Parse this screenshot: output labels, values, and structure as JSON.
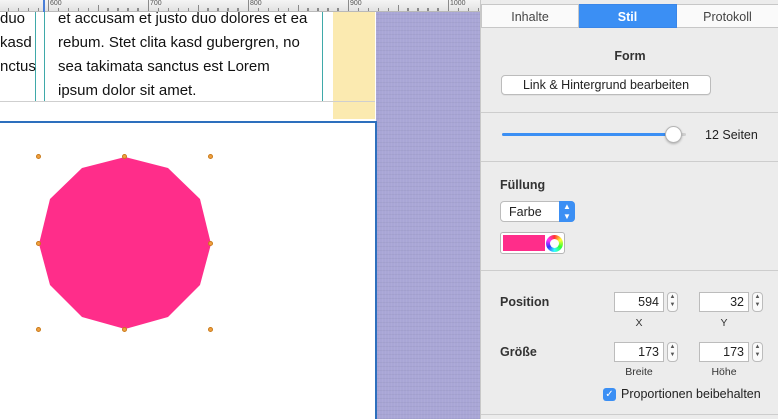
{
  "ruler": {
    "labels": [
      "600",
      "700",
      "800",
      "900",
      "1000"
    ]
  },
  "document": {
    "left_column_lines": [
      "duo",
      "kasd",
      "nctus"
    ],
    "main_column_lines": [
      "et accusam et justo duo dolores et ea",
      "rebum. Stet clita kasd gubergren, no",
      "sea takimata sanctus est Lorem",
      "ipsum dolor sit amet."
    ]
  },
  "shape": {
    "type": "polygon",
    "sides": 12,
    "fill_color": "#ff2d8a"
  },
  "inspector": {
    "tabs": [
      {
        "label": "Inhalte",
        "active": false
      },
      {
        "label": "Stil",
        "active": true
      },
      {
        "label": "Protokoll",
        "active": false
      }
    ],
    "form_section": {
      "title": "Form",
      "button_label": "Link & Hintergrund bearbeiten"
    },
    "sides_slider": {
      "fraction": 0.93,
      "label": "12 Seiten"
    },
    "fill_section": {
      "title": "Füllung",
      "select_value": "Farbe",
      "color": "#ff2d8a"
    },
    "position_section": {
      "title": "Position",
      "x_value": "594",
      "y_value": "32",
      "x_label": "X",
      "y_label": "Y"
    },
    "size_section": {
      "title": "Größe",
      "width_value": "173",
      "height_value": "173",
      "width_label": "Breite",
      "height_label": "Höhe"
    },
    "keep_proportions": {
      "checked": true,
      "label": "Proportionen beibehalten"
    }
  },
  "colors": {
    "accent": "#3b8ff4",
    "selection_border": "#2d6fbd",
    "handle": "#f0a040",
    "yellow_column": "#fbeab0",
    "lilac_background": "#a9a6d6"
  }
}
